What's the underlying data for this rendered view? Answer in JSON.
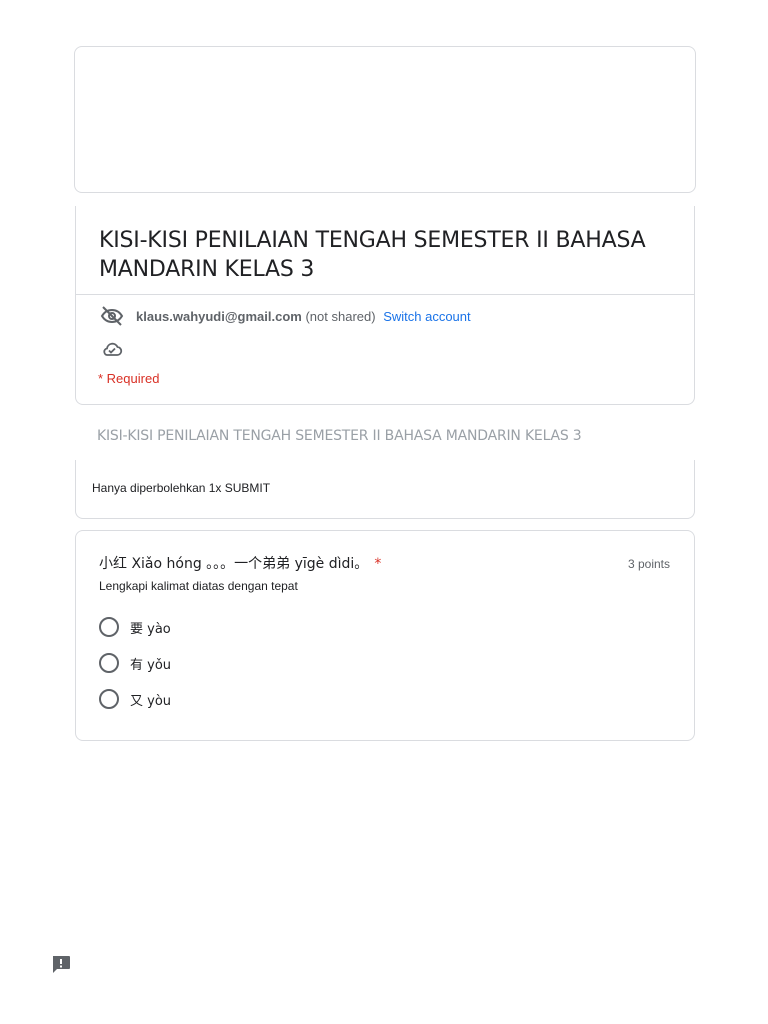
{
  "form": {
    "title": "KISI-KISI PENILAIAN TENGAH SEMESTER II BAHASA MANDARIN KELAS 3",
    "account": {
      "email": "klaus.wahyudi@gmail.com",
      "shared_status": "(not shared)",
      "switch_label": "Switch account"
    },
    "required_label": "* Required"
  },
  "section": {
    "title": "KISI-KISI PENILAIAN TENGAH SEMESTER II BAHASA MANDARIN KELAS 3",
    "description": "Hanya diperbolehkan 1x SUBMIT"
  },
  "question": {
    "title": "小红 Xiǎo hóng 。。。一个弟弟 yīgè dìdi。",
    "required_marker": "*",
    "points": "3 points",
    "help_text": "Lengkapi kalimat diatas dengan tepat",
    "options": [
      {
        "label": "要 yào"
      },
      {
        "label": "有 yǒu"
      },
      {
        "label": "又 yòu"
      }
    ]
  },
  "colors": {
    "accent": "#1a73e8",
    "required": "#d93025",
    "border": "#dadce0",
    "muted_text": "#5f6368"
  },
  "icons": {
    "visibility": "eye-off-icon",
    "cloud": "cloud-check-icon",
    "report": "report-feedback-icon"
  }
}
